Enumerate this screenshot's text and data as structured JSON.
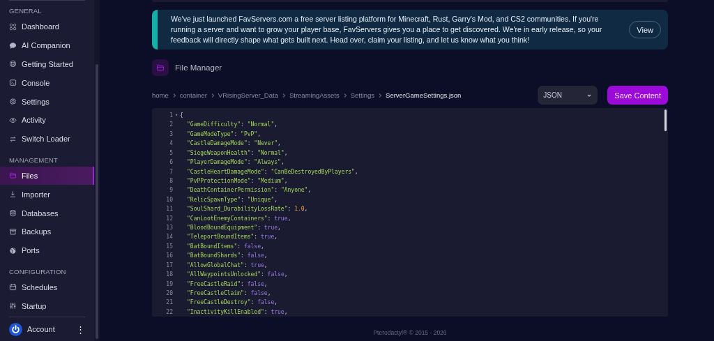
{
  "sidebar": {
    "sections": [
      {
        "title": "GENERAL",
        "items": [
          {
            "label": "Dashboard",
            "selected": false
          },
          {
            "label": "AI Companion",
            "selected": false
          },
          {
            "label": "Getting Started",
            "selected": false
          },
          {
            "label": "Console",
            "selected": false
          },
          {
            "label": "Settings",
            "selected": false
          },
          {
            "label": "Activity",
            "selected": false
          },
          {
            "label": "Switch Loader",
            "selected": false
          }
        ]
      },
      {
        "title": "MANAGEMENT",
        "items": [
          {
            "label": "Files",
            "selected": true
          },
          {
            "label": "Importer",
            "selected": false
          },
          {
            "label": "Databases",
            "selected": false
          },
          {
            "label": "Backups",
            "selected": false
          },
          {
            "label": "Ports",
            "selected": false
          }
        ]
      },
      {
        "title": "CONFIGURATION",
        "items": [
          {
            "label": "Schedules",
            "selected": false
          },
          {
            "label": "Startup",
            "selected": false
          }
        ]
      }
    ],
    "account": {
      "label": "Account",
      "menu": "⋮"
    }
  },
  "banner": {
    "text": "We've just launched FavServers.com a free server listing platform for Minecraft, Rust, Garry's Mod, and CS2 communities. If you're running a server and want to grow your player base, FavServers gives you a place to get discovered. We're in early release, so your feedback will directly shape what gets built next. Head over, claim your listing, and let us know what you think!",
    "button": "View"
  },
  "header": {
    "title": "File Manager"
  },
  "breadcrumb": [
    {
      "label": "home",
      "current": false
    },
    {
      "label": "container",
      "current": false
    },
    {
      "label": "VRisingServer_Data",
      "current": false
    },
    {
      "label": "StreamingAssets",
      "current": false
    },
    {
      "label": "Settings",
      "current": false
    },
    {
      "label": "ServerGameSettings.json",
      "current": true
    }
  ],
  "mode_select": {
    "value": "JSON"
  },
  "save_button": "Save Content",
  "editor": {
    "lines": [
      {
        "number": "1",
        "kind": "brace",
        "fold": "▾",
        "text": "{"
      },
      {
        "number": "2",
        "kind": "string",
        "key": "\"GameDifficulty\"",
        "sep": ": ",
        "value": "\"Normal\"",
        "tail": ","
      },
      {
        "number": "3",
        "kind": "string",
        "key": "\"GameModeType\"",
        "sep": ": ",
        "value": "\"PvP\"",
        "tail": ","
      },
      {
        "number": "4",
        "kind": "string",
        "key": "\"CastleDamageMode\"",
        "sep": ": ",
        "value": "\"Never\"",
        "tail": ","
      },
      {
        "number": "5",
        "kind": "string",
        "key": "\"SiegeWeaponHealth\"",
        "sep": ": ",
        "value": "\"Normal\"",
        "tail": ","
      },
      {
        "number": "6",
        "kind": "string",
        "key": "\"PlayerDamageMode\"",
        "sep": ": ",
        "value": "\"Always\"",
        "tail": ","
      },
      {
        "number": "7",
        "kind": "string",
        "key": "\"CastleHeartDamageMode\"",
        "sep": ": ",
        "value": "\"CanBeDestroyedByPlayers\"",
        "tail": ","
      },
      {
        "number": "8",
        "kind": "string",
        "key": "\"PvPProtectionMode\"",
        "sep": ": ",
        "value": "\"Medium\"",
        "tail": ","
      },
      {
        "number": "9",
        "kind": "string",
        "key": "\"DeathContainerPermission\"",
        "sep": ": ",
        "value": "\"Anyone\"",
        "tail": ","
      },
      {
        "number": "10",
        "kind": "string",
        "key": "\"RelicSpawnType\"",
        "sep": ": ",
        "value": "\"Unique\"",
        "tail": ","
      },
      {
        "number": "11",
        "kind": "number",
        "key": "\"SoulShard_DurabilityLossRate\"",
        "sep": ": ",
        "value": "1.0",
        "tail": ","
      },
      {
        "number": "12",
        "kind": "boolean",
        "key": "\"CanLootEnemyContainers\"",
        "sep": ": ",
        "value": "true",
        "tail": ","
      },
      {
        "number": "13",
        "kind": "boolean",
        "key": "\"BloodBoundEquipment\"",
        "sep": ": ",
        "value": "true",
        "tail": ","
      },
      {
        "number": "14",
        "kind": "boolean",
        "key": "\"TeleportBoundItems\"",
        "sep": ": ",
        "value": "true",
        "tail": ","
      },
      {
        "number": "15",
        "kind": "boolean",
        "key": "\"BatBoundItems\"",
        "sep": ": ",
        "value": "false",
        "tail": ","
      },
      {
        "number": "16",
        "kind": "boolean",
        "key": "\"BatBoundShards\"",
        "sep": ": ",
        "value": "false",
        "tail": ","
      },
      {
        "number": "17",
        "kind": "boolean",
        "key": "\"AllowGlobalChat\"",
        "sep": ": ",
        "value": "true",
        "tail": ","
      },
      {
        "number": "18",
        "kind": "boolean",
        "key": "\"AllWaypointsUnlocked\"",
        "sep": ": ",
        "value": "false",
        "tail": ","
      },
      {
        "number": "19",
        "kind": "boolean",
        "key": "\"FreeCastleRaid\"",
        "sep": ": ",
        "value": "false",
        "tail": ","
      },
      {
        "number": "20",
        "kind": "boolean",
        "key": "\"FreeCastleClaim\"",
        "sep": ": ",
        "value": "false",
        "tail": ","
      },
      {
        "number": "21",
        "kind": "boolean",
        "key": "\"FreeCastleDestroy\"",
        "sep": ": ",
        "value": "false",
        "tail": ","
      },
      {
        "number": "22",
        "kind": "boolean",
        "key": "\"InactivityKillEnabled\"",
        "sep": ": ",
        "value": "true",
        "tail": ","
      }
    ]
  },
  "footer": "Pterodactyl® © 2015 - 2026"
}
